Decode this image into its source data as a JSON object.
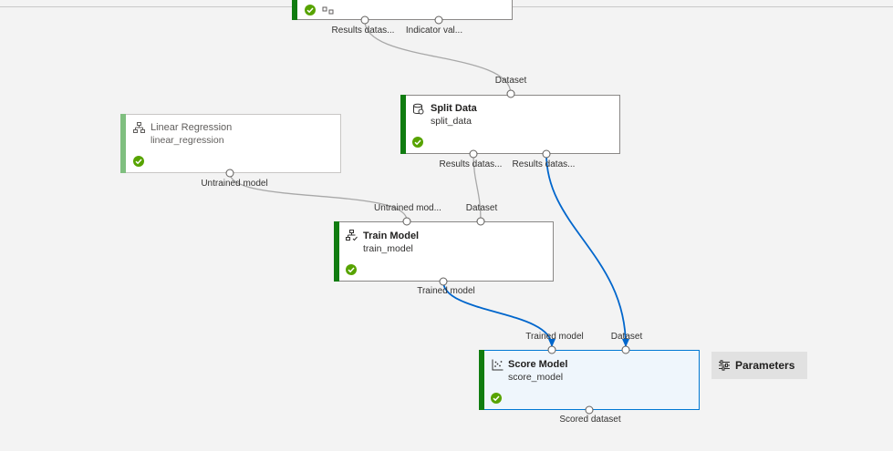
{
  "colors": {
    "canvas": "#f3f3f3",
    "node_status_bar": "#107c10",
    "selected_edge": "#0066cc",
    "edge": "#a8a8a8",
    "selected_node_border": "#0078d4"
  },
  "nodes": {
    "top_node": {
      "ports_out": [
        "Results datas...",
        "Indicator val..."
      ]
    },
    "linear_regression": {
      "title": "Linear Regression",
      "subtitle": "linear_regression",
      "icon": "tree-icon",
      "status": "completed",
      "ports_out": [
        "Untrained model"
      ]
    },
    "split_data": {
      "title": "Split Data",
      "subtitle": "split_data",
      "icon": "split-data-icon",
      "status": "completed",
      "ports_in": [
        "Dataset"
      ],
      "ports_out": [
        "Results datas...",
        "Results datas..."
      ]
    },
    "train_model": {
      "title": "Train Model",
      "subtitle": "train_model",
      "icon": "train-model-icon",
      "status": "completed",
      "ports_in": [
        "Untrained mod...",
        "Dataset"
      ],
      "ports_out": [
        "Trained model"
      ]
    },
    "score_model": {
      "title": "Score Model",
      "subtitle": "score_model",
      "icon": "scatter-icon",
      "status": "completed",
      "ports_in": [
        "Trained model",
        "Dataset"
      ],
      "ports_out": [
        "Scored dataset"
      ]
    }
  },
  "parameters_button": {
    "label": "Parameters",
    "icon": "sliders-icon"
  }
}
